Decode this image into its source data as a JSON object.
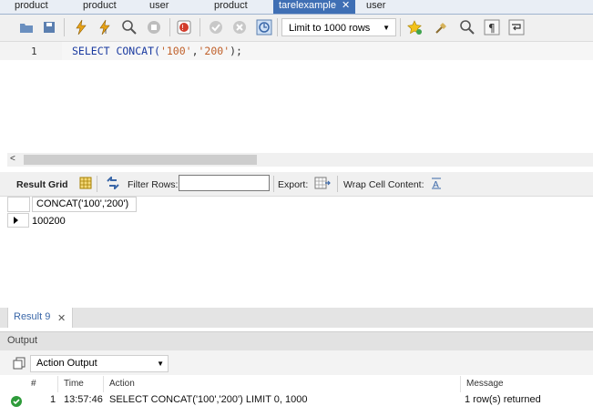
{
  "tabs": [
    {
      "label": "product",
      "active": false
    },
    {
      "label": "product",
      "active": false
    },
    {
      "label": "user",
      "active": false
    },
    {
      "label": "product",
      "active": false
    },
    {
      "label": "tarelexample",
      "active": true
    },
    {
      "label": "user",
      "active": false
    }
  ],
  "toolbar": {
    "limit_label": "Limit to 1000 rows",
    "icons": [
      "open-folder-icon",
      "save-icon",
      "execute-icon",
      "execute-current-icon",
      "explain-icon",
      "stop-icon",
      "toggle-error-icon",
      "commit-icon",
      "rollback-icon",
      "autocommit-icon",
      "limit-dropdown",
      "bookmark-icon",
      "beautify-icon",
      "find-icon",
      "invisible-chars-icon",
      "wrap-icon"
    ]
  },
  "editor": {
    "line_number": "1",
    "sql_keyword": "SELECT CONCAT(",
    "sql_arg1": "'100'",
    "sql_comma": ",",
    "sql_arg2": "'200'",
    "sql_tail": ");"
  },
  "result_toolbar": {
    "result_grid": "Result Grid",
    "filter_rows": "Filter Rows:",
    "filter_value": "",
    "export": "Export:",
    "wrap": "Wrap Cell Content:"
  },
  "grid": {
    "columns": [
      "CONCAT('100','200')"
    ],
    "rows": [
      [
        "100200"
      ]
    ]
  },
  "result_tab": {
    "label": "Result 9"
  },
  "output": {
    "header": "Output",
    "mode": "Action Output",
    "columns": [
      "#",
      "Time",
      "Action",
      "Message"
    ],
    "rows": [
      {
        "num": "1",
        "time": "13:57:46",
        "action": "SELECT CONCAT('100','200') LIMIT 0, 1000",
        "message": "1 row(s) returned"
      }
    ]
  },
  "colors": {
    "active_tab": "#3f6fb4",
    "keyword": "#1a3aa0",
    "string": "#c0602a",
    "success": "#2e9b3a"
  }
}
